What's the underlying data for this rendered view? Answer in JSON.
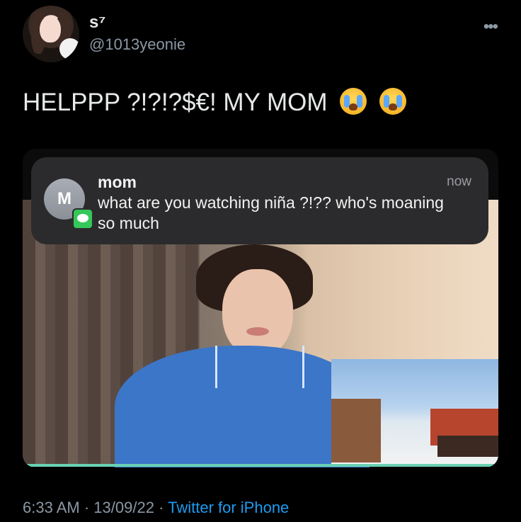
{
  "tweet": {
    "display_name": "s⁷",
    "handle": "@1013yeonie",
    "text": "HELPPP ?!?!?$€! MY MOM",
    "emoji": [
      "loudly-crying-face",
      "loudly-crying-face"
    ],
    "time": "6:33 AM",
    "date": "13/09/22",
    "separator": "·",
    "source": "Twitter for iPhone"
  },
  "notification": {
    "avatar_initial": "M",
    "sender": "mom",
    "time": "now",
    "message": "what are you watching niña ?!?? who's moaning so much",
    "app_icon": "messages-icon"
  },
  "colors": {
    "background": "#000000",
    "text": "#e7e9ea",
    "muted": "#8b98a5",
    "link": "#1d9bf0",
    "notification_bg": "#2b2b2d",
    "messages_green": "#34c759"
  }
}
